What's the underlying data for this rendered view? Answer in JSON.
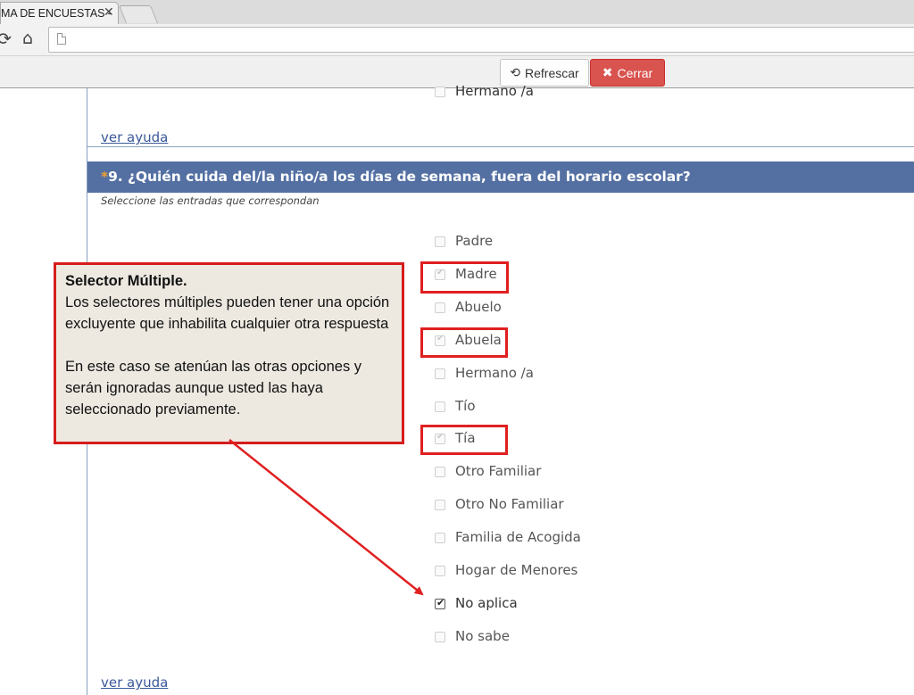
{
  "browser": {
    "tab_title": "MA DE ENCUESTAS -",
    "tab_close": "✕"
  },
  "actions": {
    "refresh_label": "Refrescar",
    "close_label": "Cerrar"
  },
  "previous_question": {
    "last_option": "Hermano /a",
    "help_link": "ver ayuda"
  },
  "question": {
    "required_mark": "*",
    "title": "9. ¿Quién cuida del/la niño/a los días de semana, fuera del horario escolar?",
    "instructions": "Seleccione las entradas que correspondan",
    "options": [
      {
        "label": "Padre",
        "state": "disabled"
      },
      {
        "label": "Madre",
        "state": "disabled-checked"
      },
      {
        "label": "Abuelo",
        "state": "disabled"
      },
      {
        "label": "Abuela",
        "state": "disabled-checked"
      },
      {
        "label": "Hermano /a",
        "state": "disabled"
      },
      {
        "label": "Tío",
        "state": "disabled"
      },
      {
        "label": "Tía",
        "state": "disabled-checked"
      },
      {
        "label": "Otro Familiar",
        "state": "disabled"
      },
      {
        "label": "Otro No Familiar",
        "state": "disabled"
      },
      {
        "label": "Familia de Acogida",
        "state": "disabled"
      },
      {
        "label": "Hogar de Menores",
        "state": "disabled"
      },
      {
        "label": "No aplica",
        "state": "checked"
      },
      {
        "label": "No sabe",
        "state": "disabled"
      }
    ],
    "help_link": "ver ayuda"
  },
  "callout": {
    "title": "Selector Múltiple.",
    "paragraph1": "Los selectores múltiples pueden tener una opción excluyente que inhabilita cualquier otra respuesta",
    "paragraph2": "En este caso se atenúan las otras opciones y serán ignoradas aunque usted las  haya seleccionado  previamente."
  },
  "colors": {
    "header_bg": "#5470a3",
    "highlight": "#e02020",
    "close_button": "#d9534f",
    "link": "#3b5998"
  }
}
